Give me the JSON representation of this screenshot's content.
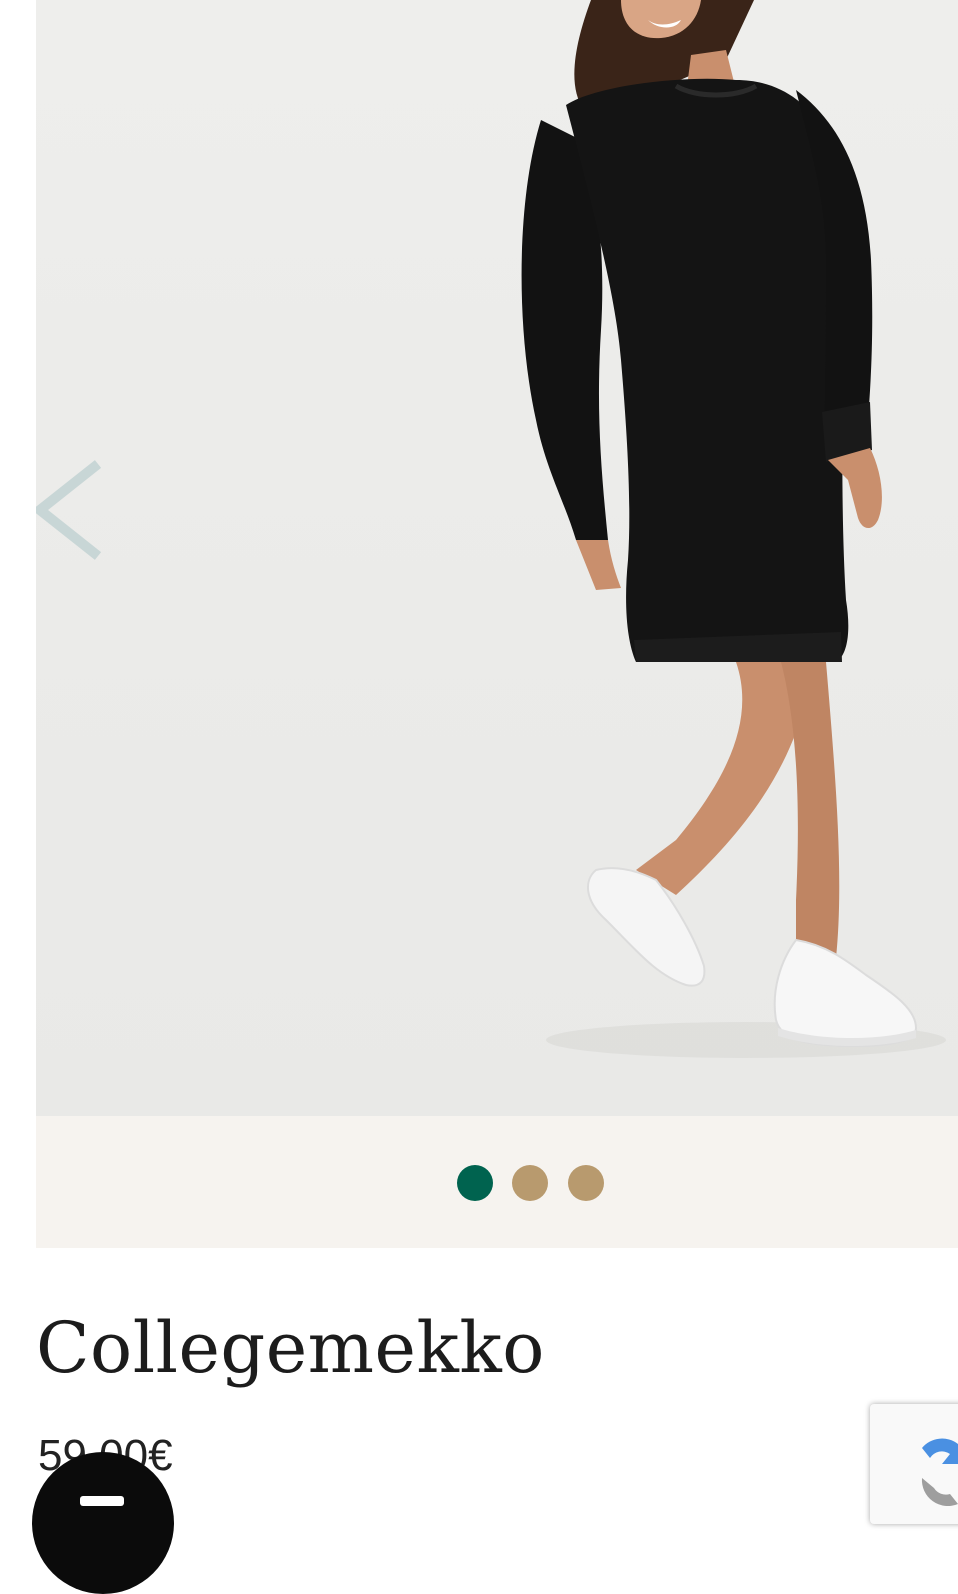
{
  "product": {
    "title": "Collegemekko",
    "price": "59,00€"
  },
  "gallery": {
    "image_description": "Woman wearing black long-sleeve sweatshirt dress with white sneakers",
    "prev_arrow_glyph": "<",
    "current_index": 1,
    "total": 3
  },
  "colors": {
    "dot_active": "#00634f",
    "dot_inactive": "#b89a6e",
    "dots_bar_bg": "#f6f3ef",
    "arrow": "#c8d6d6"
  },
  "icons": {
    "prev": "chevron-left-icon",
    "chat": "chat-icon",
    "captcha": "recaptcha-icon"
  }
}
